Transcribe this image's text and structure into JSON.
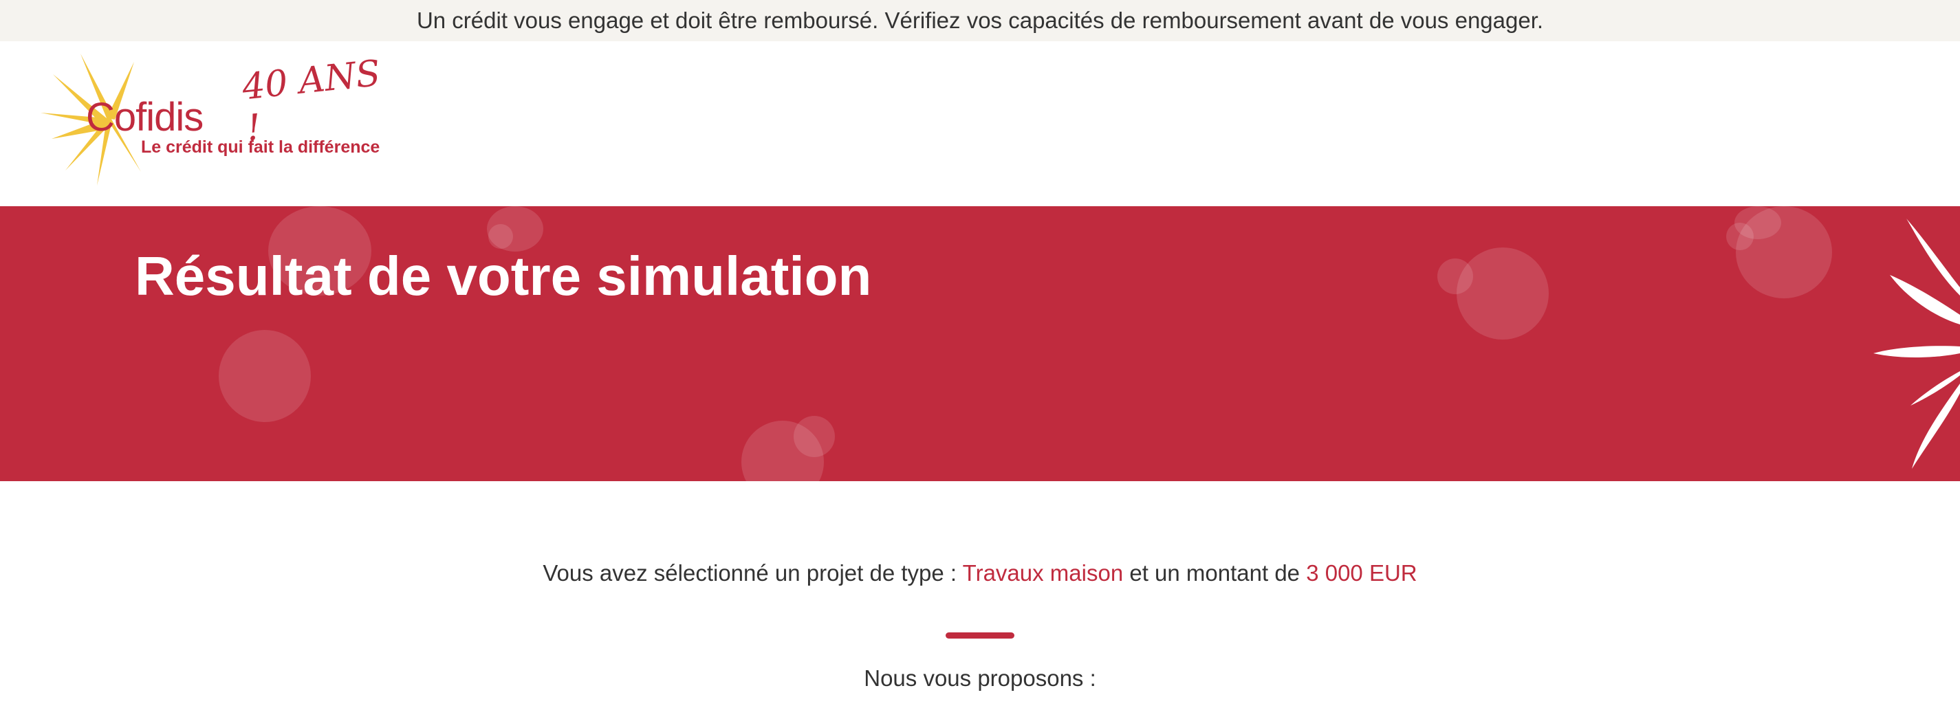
{
  "warning": {
    "text": "Un crédit vous engage et doit être remboursé. Vérifiez vos capacités de remboursement avant de vous engager."
  },
  "logo": {
    "brand": "Cofidis",
    "anniversary": "40 ANS !",
    "tagline": "Le crédit qui fait la différence"
  },
  "banner": {
    "title": "Résultat de votre simulation"
  },
  "summary": {
    "prefix": "Vous avez sélectionné un projet de type : ",
    "project_type": "Travaux maison",
    "middle": " et un montant de ",
    "amount": "3 000 EUR"
  },
  "propose": {
    "text": "Nous vous proposons :"
  },
  "colors": {
    "brand_red": "#c02b3e",
    "sun_yellow": "#f2c53d",
    "warning_bg": "#f5f3ef",
    "text": "#333333"
  },
  "icons": [
    "cofidis-sun-logo-icon",
    "banner-petals-icon"
  ]
}
